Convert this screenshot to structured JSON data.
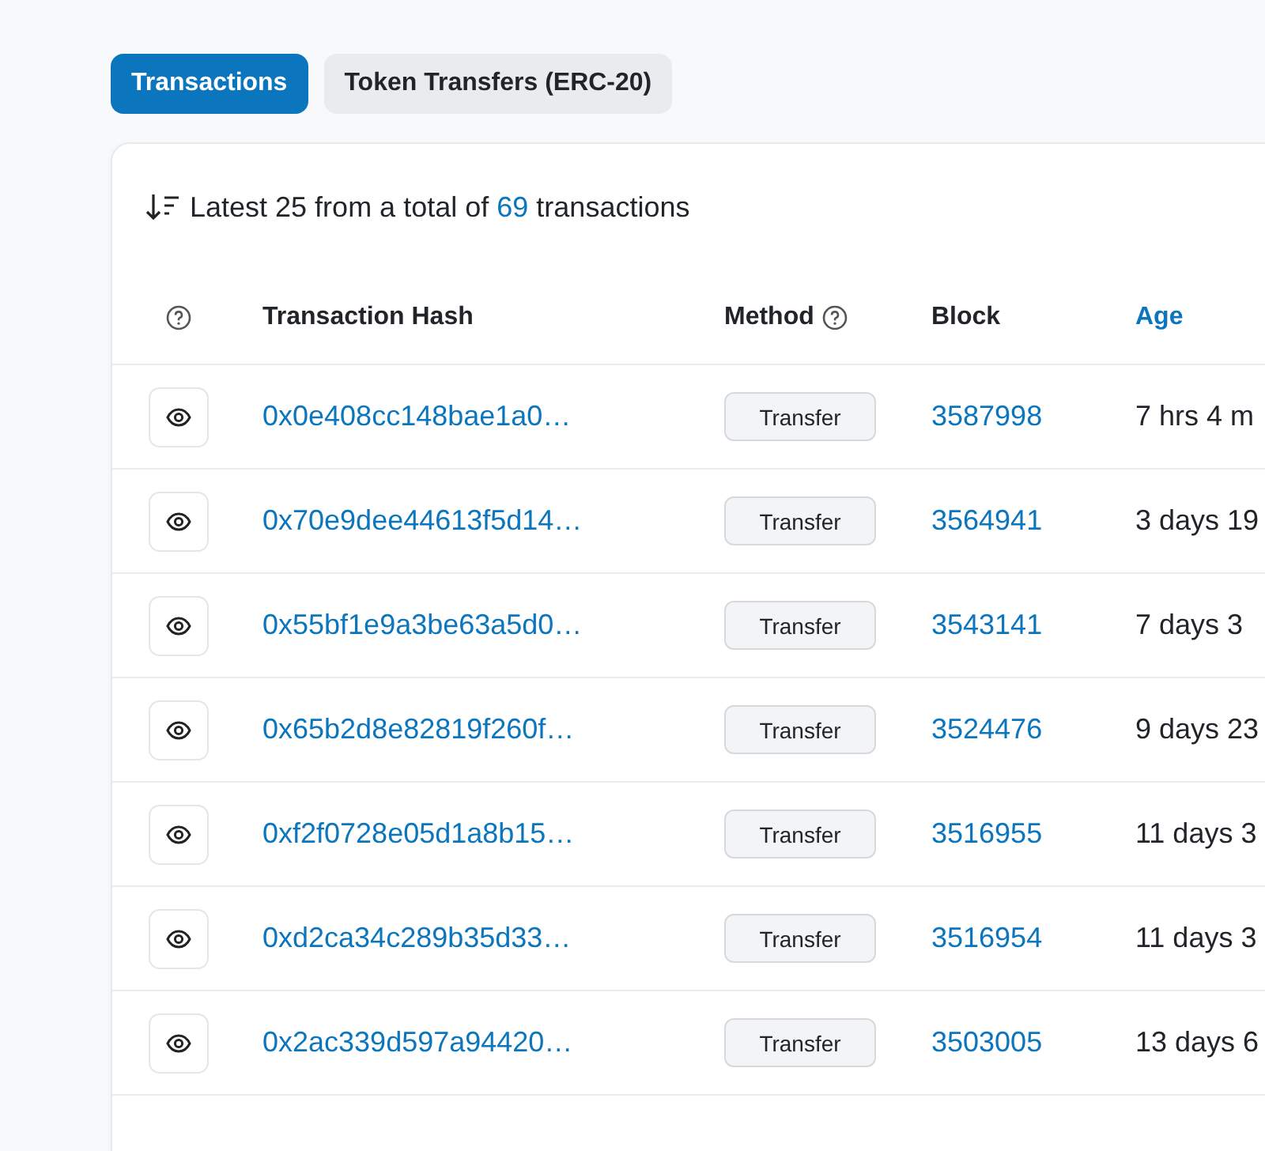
{
  "tabs": [
    {
      "label": "Transactions",
      "selected": true
    },
    {
      "label": "Token Transfers (ERC-20)",
      "selected": false
    }
  ],
  "summary": {
    "before": "Latest 25 from a total of",
    "count": "69",
    "after": "transactions"
  },
  "table": {
    "columns": [
      {
        "kind": "help"
      },
      {
        "kind": "text",
        "label": "Transaction Hash"
      },
      {
        "kind": "help-text",
        "label": "Method"
      },
      {
        "kind": "text",
        "label": "Block"
      },
      {
        "kind": "link",
        "label": "Age"
      }
    ],
    "rows": [
      {
        "hash": "0x0e408cc148bae1a0…",
        "method": "Transfer",
        "block": "3587998",
        "age": "7 hrs 4 m"
      },
      {
        "hash": "0x70e9dee44613f5d14…",
        "method": "Transfer",
        "block": "3564941",
        "age": "3 days 19"
      },
      {
        "hash": "0x55bf1e9a3be63a5d0…",
        "method": "Transfer",
        "block": "3543141",
        "age": "7 days 3"
      },
      {
        "hash": "0x65b2d8e82819f260f…",
        "method": "Transfer",
        "block": "3524476",
        "age": "9 days 23"
      },
      {
        "hash": "0xf2f0728e05d1a8b15…",
        "method": "Transfer",
        "block": "3516955",
        "age": "11 days 3"
      },
      {
        "hash": "0xd2ca34c289b35d33…",
        "method": "Transfer",
        "block": "3516954",
        "age": "11 days 3"
      },
      {
        "hash": "0x2ac339d597a94420…",
        "method": "Transfer",
        "block": "3503005",
        "age": "13 days 6"
      }
    ]
  }
}
